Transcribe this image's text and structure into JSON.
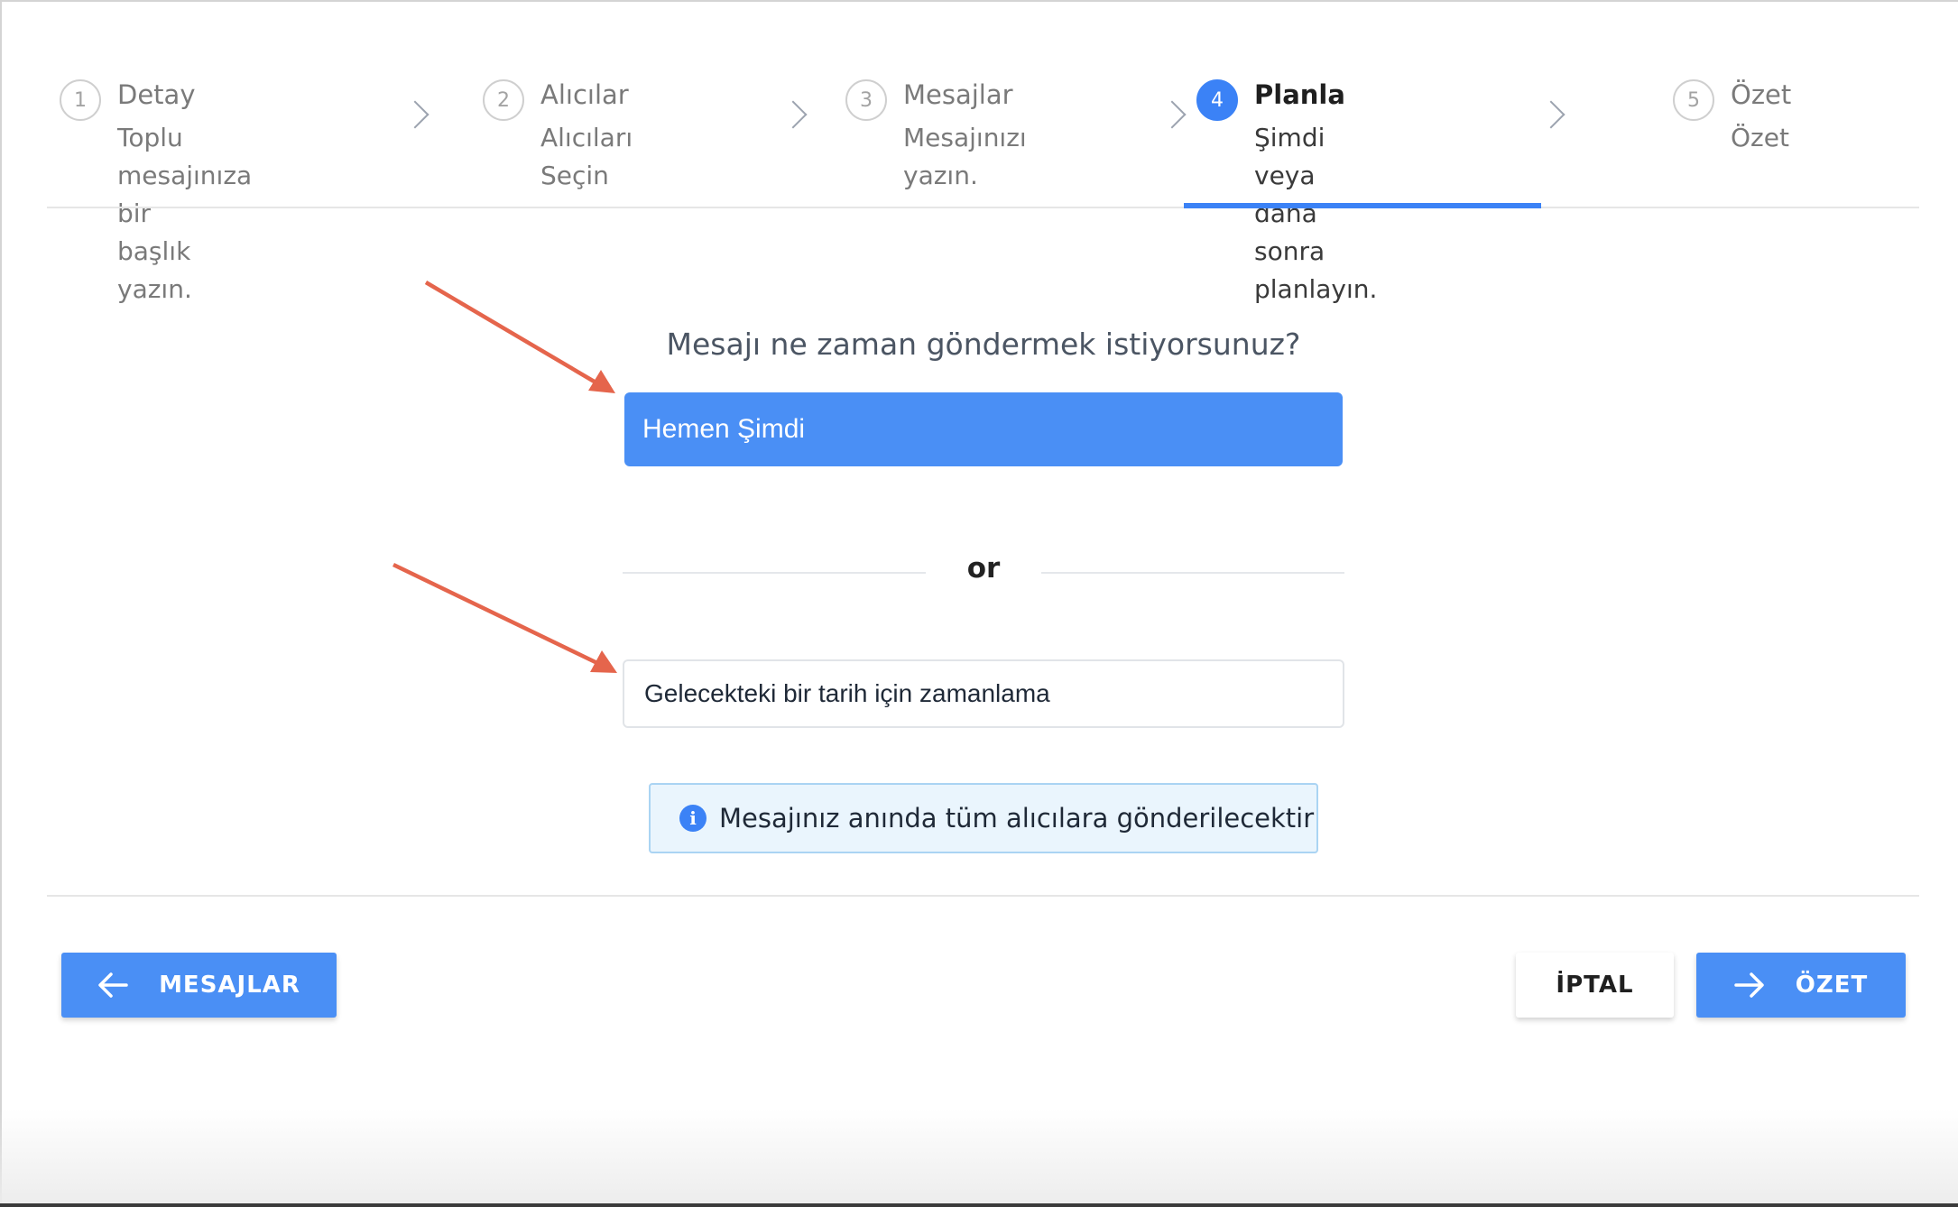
{
  "stepper": {
    "steps": [
      {
        "number": "1",
        "title": "Detay",
        "subtitle_line1": "Toplu mesajınıza bir",
        "subtitle_line2": "başlık yazın."
      },
      {
        "number": "2",
        "title": "Alıcılar",
        "subtitle_line1": "Alıcıları Seçin",
        "subtitle_line2": ""
      },
      {
        "number": "3",
        "title": "Mesajlar",
        "subtitle_line1": "Mesajınızı yazın.",
        "subtitle_line2": ""
      },
      {
        "number": "4",
        "title": "Planla",
        "subtitle_line1": "Şimdi veya daha",
        "subtitle_line2": "sonra planlayın."
      },
      {
        "number": "5",
        "title": "Özet",
        "subtitle_line1": "Özet",
        "subtitle_line2": ""
      }
    ],
    "active_step": 4
  },
  "schedule": {
    "question": "Mesajı ne zaman göndermek istiyorsunuz?",
    "now_option": "Hemen Şimdi",
    "separator": "or",
    "future_option": "Gelecekteki bir tarih için zamanlama",
    "info_text": "Mesajınız anında tüm alıcılara gönderilecektir"
  },
  "footer": {
    "back_label": "MESAJLAR",
    "cancel_label": "İPTAL",
    "next_label": "ÖZET"
  },
  "colors": {
    "accent": "#4a8ff5",
    "info_bg": "#eaf5fd",
    "annotation_arrow": "#e5654c"
  },
  "icons": {
    "back": "arrow-left-icon",
    "next": "arrow-right-icon",
    "info": "info-icon",
    "step_separator": "chevron-right-icon"
  }
}
